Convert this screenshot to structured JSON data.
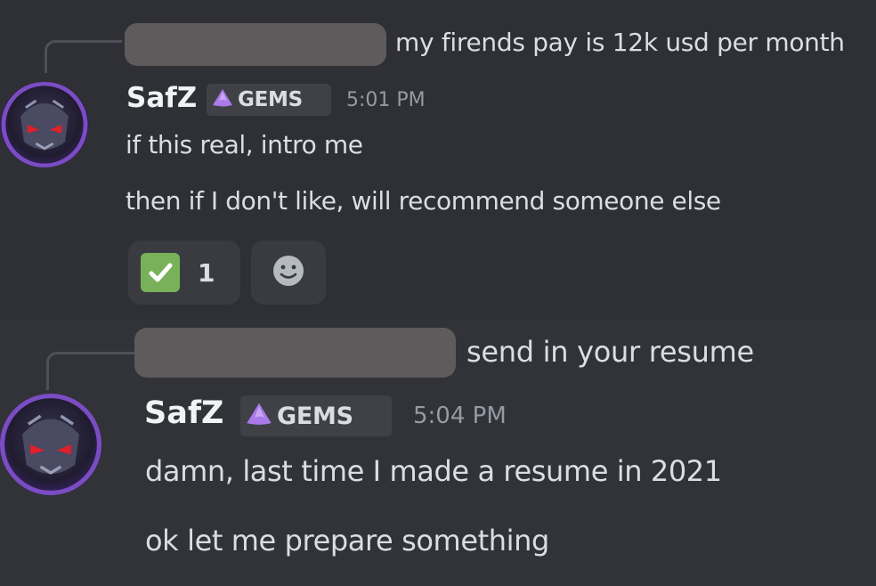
{
  "messages": [
    {
      "reply_preview": "my firends pay is 12k usd per month",
      "author": "SafZ",
      "tag": "GEMS",
      "time": "5:01 PM",
      "lines": [
        "if this real, intro me",
        "then if I don't like, will recommend someone else"
      ],
      "reactions": [
        {
          "emoji": "white-check-mark",
          "count": "1"
        }
      ]
    },
    {
      "reply_preview": "send in your resume",
      "author": "SafZ",
      "tag": "GEMS",
      "time": "5:04 PM",
      "lines": [
        "damn, last time I made a resume in 2021",
        "ok let me prepare something"
      ]
    }
  ],
  "colors": {
    "background": "#313338",
    "highlight_background": "#2e3035",
    "username": "#f2f3f5",
    "text": "#dbdee1",
    "timestamp": "#949ba4",
    "tag_background": "#3f4147",
    "gem": "#a97ae8",
    "check": "#78b159"
  }
}
